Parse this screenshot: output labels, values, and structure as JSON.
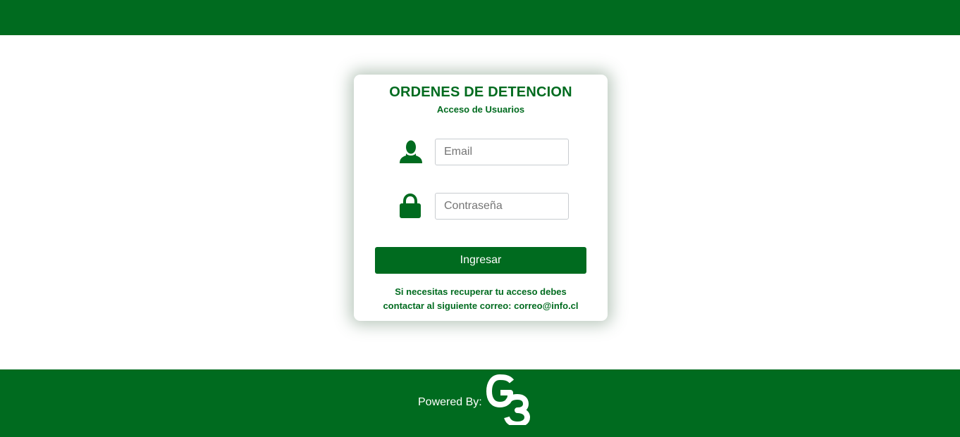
{
  "header": {
    "color": "#006b1f"
  },
  "login": {
    "title": "ORDENES DE DETENCION",
    "subtitle": "Acceso de Usuarios",
    "email_placeholder": "Email",
    "password_placeholder": "Contraseña",
    "submit_label": "Ingresar",
    "help_line1": "Si necesitas recuperar tu acceso debes",
    "help_line2": "contactar al siguiente correo: correo@info.cl",
    "icons": [
      "user-icon",
      "lock-icon"
    ]
  },
  "footer": {
    "powered_by": "Powered By:",
    "logo_text": "G3",
    "color": "#006b1f"
  }
}
